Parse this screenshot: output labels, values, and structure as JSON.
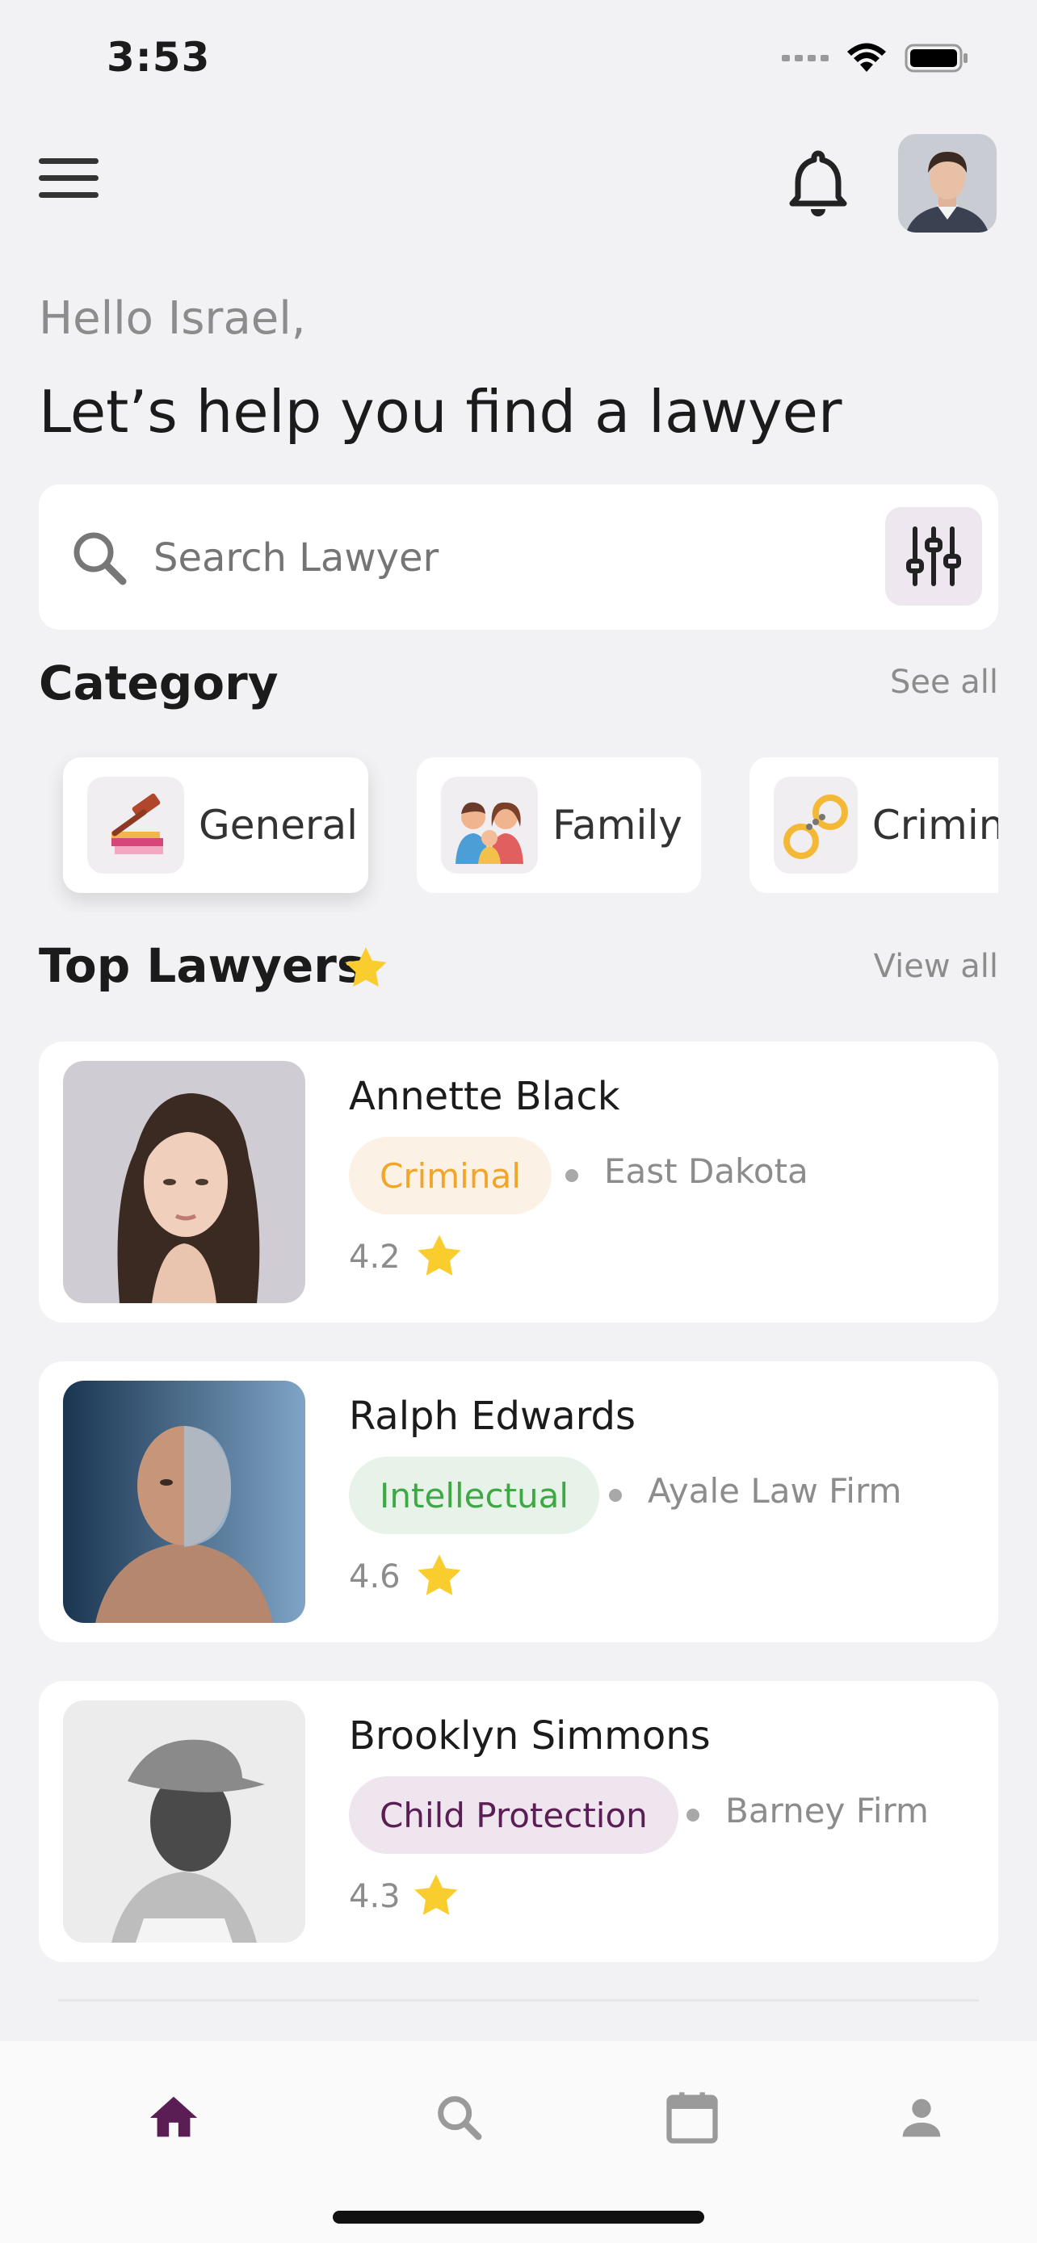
{
  "status_bar": {
    "time": "3:53"
  },
  "header": {
    "greeting": "Hello Israel,",
    "headline": "Let’s help you find a lawyer"
  },
  "search": {
    "placeholder": "Search Lawyer",
    "value": ""
  },
  "category_section": {
    "title": "Category",
    "see_all": "See all",
    "items": [
      {
        "label": "General",
        "icon": "gavel-books-icon"
      },
      {
        "label": "Family",
        "icon": "family-icon"
      },
      {
        "label": "Criminal",
        "icon": "handcuffs-icon"
      }
    ]
  },
  "top_lawyers": {
    "title": "Top Lawyers",
    "view_all": "View all",
    "items": [
      {
        "name": "Annette Black",
        "category": "Criminal",
        "firm": "East Dakota",
        "rating": "4.2",
        "tag_bg": "#fbf1e4",
        "tag_fg": "#f1a52a"
      },
      {
        "name": "Ralph Edwards",
        "category": "Intellectual",
        "firm": "Ayale Law Firm",
        "rating": "4.6",
        "tag_bg": "#e7f3e8",
        "tag_fg": "#3ea845"
      },
      {
        "name": "Brooklyn Simmons",
        "category": "Child Protection",
        "firm": "Barney Firm",
        "rating": "4.3",
        "tag_bg": "#efe5ee",
        "tag_fg": "#5a1e55"
      }
    ]
  },
  "colors": {
    "accent": "#5a1e55",
    "star": "#f9cd2e",
    "muted": "#8c8c8c"
  },
  "tab_bar": {
    "items": [
      "home-icon",
      "search-icon",
      "calendar-icon",
      "profile-icon"
    ],
    "active": "home-icon"
  }
}
